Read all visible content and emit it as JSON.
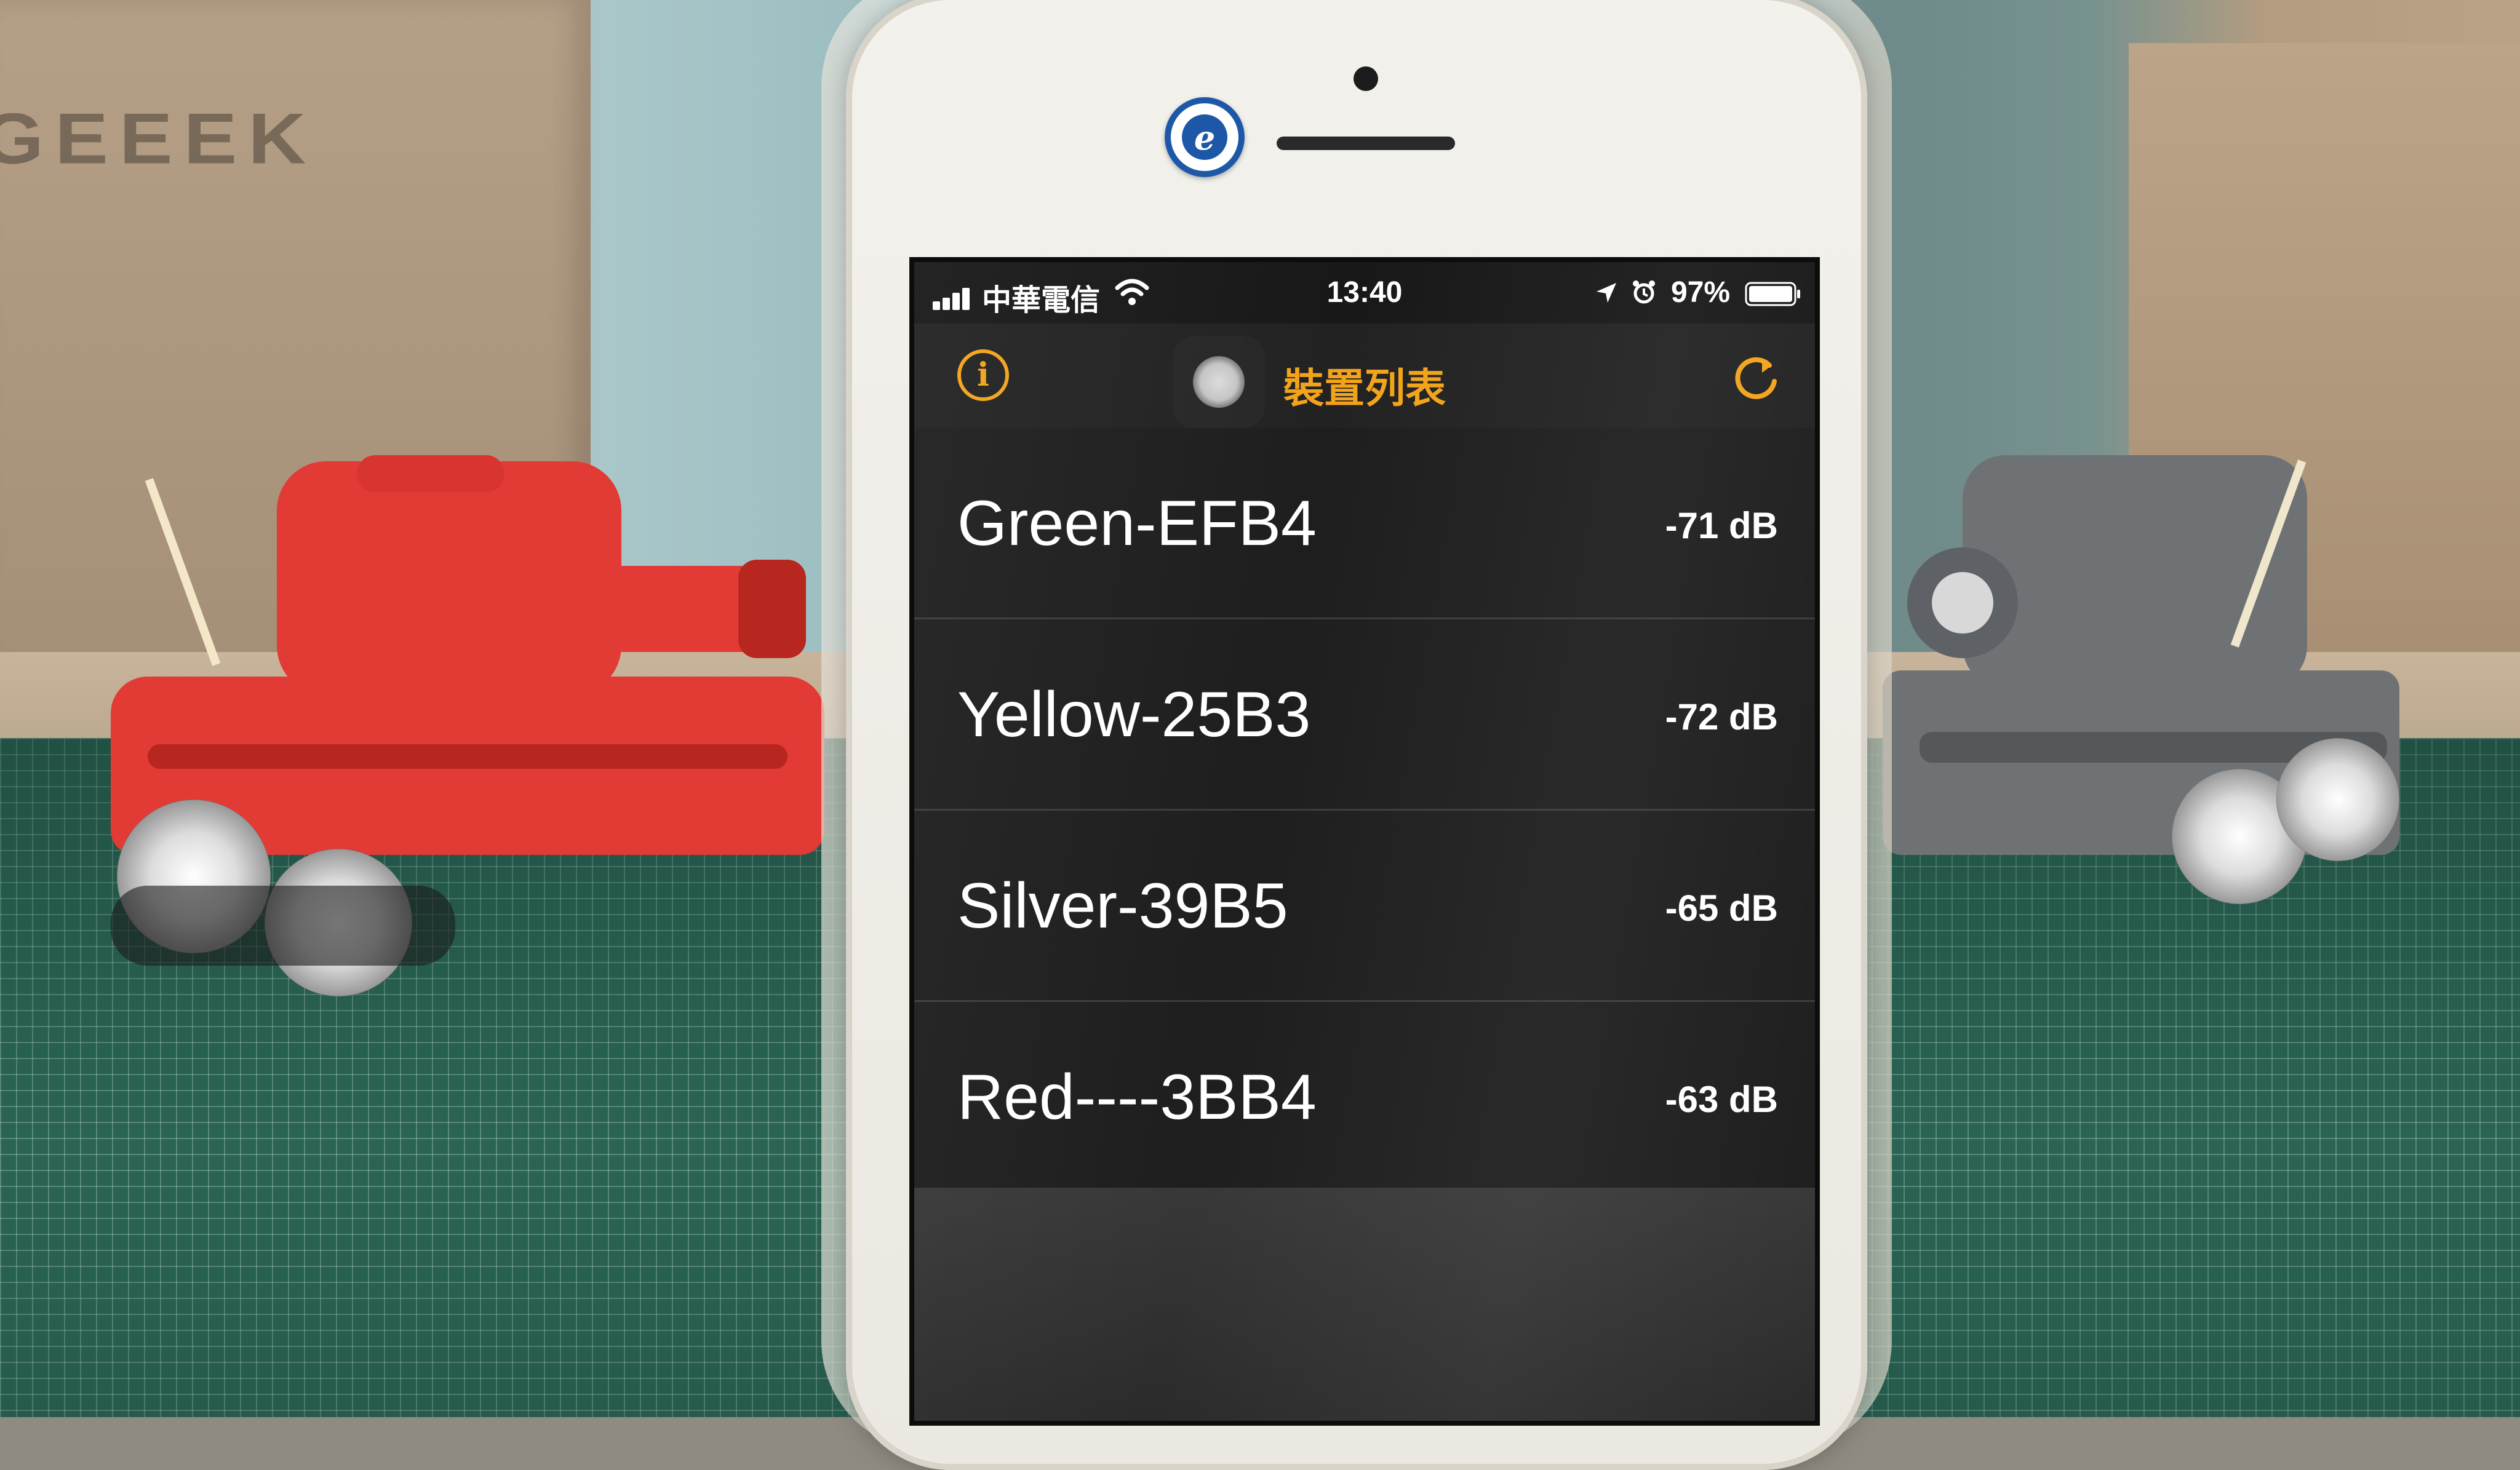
{
  "background": {
    "box_label": "GEEEK"
  },
  "status_bar": {
    "carrier": "中華電信",
    "time": "13:40",
    "battery": "97%"
  },
  "nav": {
    "title": "裝置列表",
    "info_icon": "info-icon",
    "refresh_icon": "refresh-icon"
  },
  "devices": [
    {
      "name": "Green-EFB4",
      "signal": "-71 dB"
    },
    {
      "name": "Yellow-25B3",
      "signal": "-72 dB"
    },
    {
      "name": "Silver-39B5",
      "signal": "-65 dB"
    },
    {
      "name": "Red----3BB4",
      "signal": "-63 dB"
    }
  ],
  "colors": {
    "accent": "#f2a31b",
    "list_background": "#1e1e1e",
    "separator": "#3b3b3b"
  }
}
